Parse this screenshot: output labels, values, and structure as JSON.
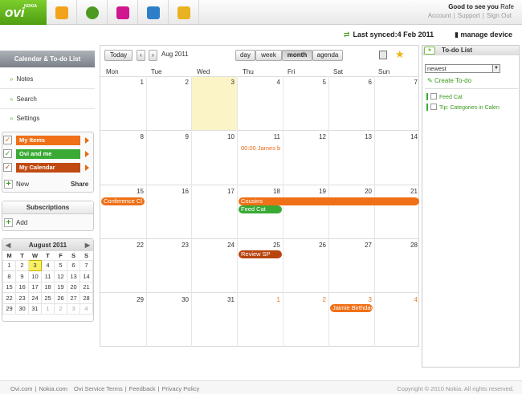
{
  "topbar": {
    "logo": "ovi",
    "logo_sub": "NOKIA",
    "apps": [
      {
        "name": "contacts-icon",
        "color": "#f2a31b"
      },
      {
        "name": "maps-icon",
        "color": "#4c9b20"
      },
      {
        "name": "music-icon",
        "color": "#d0178d"
      },
      {
        "name": "store-icon",
        "color": "#2f7fc8"
      },
      {
        "name": "mail-icon",
        "color": "#e8b220"
      }
    ],
    "greeting": "Good to see you",
    "user": "Rafe",
    "links": [
      "Account",
      "Support",
      "Sign Out"
    ]
  },
  "sync": {
    "label": "Last synced:4 Feb 2011",
    "manage": "manage device"
  },
  "sidebar": {
    "title": "Calendar & To-do List",
    "nav": [
      "Notes",
      "Search",
      "Settings"
    ],
    "calendars": [
      {
        "label": "My Items",
        "color": "#f07018"
      },
      {
        "label": "Ovi and me",
        "color": "#3aaa35"
      },
      {
        "label": "My Calendar",
        "color": "#c04a12"
      }
    ],
    "new_label": "New",
    "share_label": "Share",
    "subscriptions_title": "Subscriptions",
    "add_label": "Add",
    "mini": {
      "title": "August 2011",
      "weekdays": [
        "M",
        "T",
        "W",
        "T",
        "F",
        "S",
        "S"
      ],
      "weeks": [
        [
          "1",
          "2",
          "3",
          "4",
          "5",
          "6",
          "7"
        ],
        [
          "8",
          "9",
          "10",
          "11",
          "12",
          "13",
          "14"
        ],
        [
          "15",
          "16",
          "17",
          "18",
          "19",
          "20",
          "21"
        ],
        [
          "22",
          "23",
          "24",
          "25",
          "26",
          "27",
          "28"
        ],
        [
          "29",
          "30",
          "31",
          "1",
          "2",
          "3",
          "4"
        ]
      ],
      "today": "3"
    }
  },
  "calendar": {
    "today_label": "Today",
    "month_label": "Aug 2011",
    "views": [
      "day",
      "week",
      "month",
      "agenda"
    ],
    "active_view": "month",
    "weekdays": [
      "Mon",
      "Tue",
      "Wed",
      "Thu",
      "Fri",
      "Sat",
      "Sun"
    ],
    "weeks": [
      [
        "1",
        "2",
        "3",
        "4",
        "5",
        "6",
        "7"
      ],
      [
        "8",
        "9",
        "10",
        "11",
        "12",
        "13",
        "14"
      ],
      [
        "15",
        "16",
        "17",
        "18",
        "19",
        "20",
        "21"
      ],
      [
        "22",
        "23",
        "24",
        "25",
        "26",
        "27",
        "28"
      ],
      [
        "29",
        "30",
        "31",
        "1",
        "2",
        "3",
        "4"
      ]
    ],
    "events": [
      {
        "label": "00:00 James b",
        "style": "text"
      },
      {
        "label": "Conference Cl",
        "color": "#f07018"
      },
      {
        "label": "Cousins",
        "color": "#f07018"
      },
      {
        "label": "Feed Cat",
        "color": "#3aaa35"
      },
      {
        "label": "Review SP",
        "color": "#b8440f"
      },
      {
        "label": "Jaimie Birthday",
        "color": "#f07018"
      }
    ]
  },
  "todo": {
    "title": "To-do List",
    "sort": "newest",
    "create": "Create To-do",
    "items": [
      "Feed Cat",
      "Tip: Categories in Calen"
    ]
  },
  "footer": {
    "links": [
      "Ovi.com",
      "Nokia.com",
      "Ovi Service Terms",
      "Feedback",
      "Privacy Policy"
    ],
    "copyright": "Copyright © 2010 Nokia. All rights reserved."
  }
}
